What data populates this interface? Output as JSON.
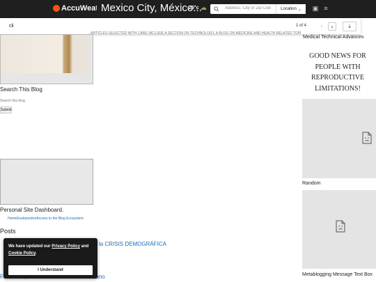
{
  "header": {
    "logo": "AccuWeather",
    "city": "Mexico City, México...",
    "temp": "25°c",
    "search_placeholder": "Address, City or Zip Code",
    "location_button": "Location"
  },
  "find_bar": {
    "query": "cli",
    "count": "1 of 4"
  },
  "blog": {
    "hidden_text": "...ARTICLES SELECTED WITH CARE INCLUDE A SECTION ON TECHNOLOGY, A BLOG ON MEDICINE AND HEALTH RELATED TOPICS",
    "search_heading": "Search This Blog",
    "search_label": "Search this blog",
    "submit_label": "Submit",
    "dashboard_title": "Personal Site Dashboard.",
    "dashboard_links": "HomeExabytesliveAccess to the Blog Ecosystem.",
    "posts_heading": "Posts",
    "post_links": [
      "la CRISIS DEMOGRÁFICA",
      "Ficción Sí, ...Ofrece la soberanía del Cano"
    ]
  },
  "cookie": {
    "text_prefix": "We have updated our ",
    "privacy_link": "Privacy Policy",
    "text_middle": " and ",
    "cookie_link": "Cookie Policy",
    "text_suffix": ".",
    "button": "I Understand"
  },
  "sidebar": {
    "top_title": "Medical Technical Advances",
    "ad_text": "GOOD NEWS FOR PEOPLE WITH REPRODUCTIVE LIMITATIONS!",
    "random_label": "Random",
    "meta_label": "Metablogging Message Text Box"
  },
  "colors": {
    "header_bg": "#1f1f1f",
    "brand_orange": "#f05514",
    "link_blue": "#1e6bb8"
  }
}
